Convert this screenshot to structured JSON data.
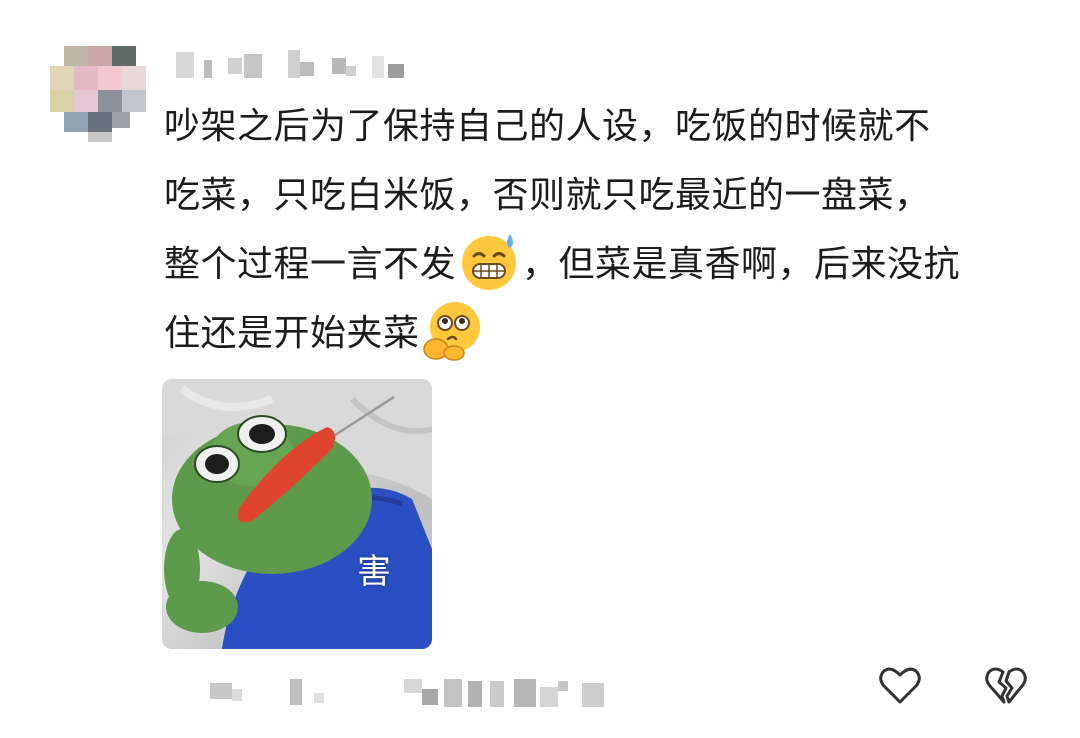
{
  "comment": {
    "lines": [
      "吵架之后为了保持自己的人设，吃饭的时候就不",
      "吃菜，只吃白米饭，否则就只吃最近的一盘菜，",
      "整个过程一言不发",
      "，但菜是真香啊，后来没抗",
      "住还是开始夹菜"
    ],
    "emoji_1": "grimacing-sweat-emoji",
    "emoji_2": "pondering-emoji"
  },
  "sticker": {
    "caption": "害",
    "icon": "pepe-frog-sticker"
  },
  "actions": {
    "like_icon": "heart-icon",
    "dislike_icon": "broken-heart-icon"
  },
  "colors": {
    "text": "#1c1c1c",
    "icon_stroke": "#333333",
    "emoji_yellow": "#ffc83d"
  }
}
